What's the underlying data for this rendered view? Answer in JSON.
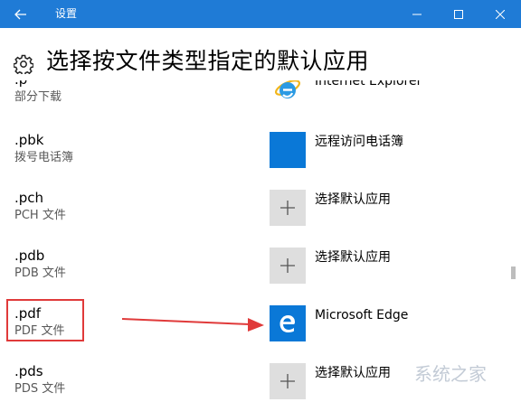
{
  "window": {
    "title": "设置",
    "accent_color": "#1f7bd6",
    "controls": [
      "minimize-icon",
      "maximize-icon",
      "close-icon"
    ]
  },
  "page": {
    "title": "选择按文件类型指定的默认应用",
    "icon": "gear-icon"
  },
  "rows": [
    {
      "ext": ".p",
      "desc": "部分下载",
      "app": "Internet Explorer",
      "icon": "internet-explorer-icon"
    },
    {
      "ext": ".pbk",
      "desc": "拨号电话簿",
      "app": "远程访问电话簿",
      "icon": "phonebook-app-icon"
    },
    {
      "ext": ".pch",
      "desc": "PCH 文件",
      "app": "选择默认应用",
      "icon": "plus-icon"
    },
    {
      "ext": ".pdb",
      "desc": "PDB 文件",
      "app": "选择默认应用",
      "icon": "plus-icon"
    },
    {
      "ext": ".pdf",
      "desc": "PDF 文件",
      "app": "Microsoft Edge",
      "icon": "microsoft-edge-icon"
    },
    {
      "ext": ".pds",
      "desc": "PDS 文件",
      "app": "选择默认应用",
      "icon": "plus-icon"
    }
  ],
  "annotation": {
    "highlight_color": "#e03a3a",
    "highlighted_ext": ".pdf"
  },
  "watermark": "系统之家"
}
